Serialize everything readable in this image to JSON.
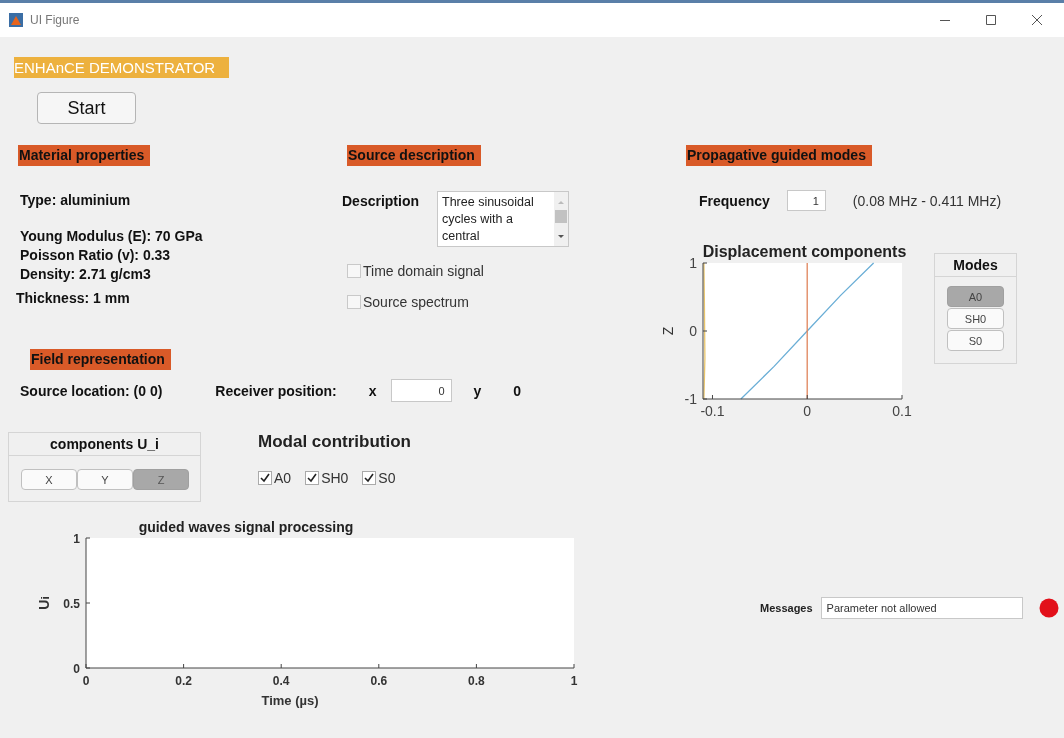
{
  "window": {
    "title": "UI Figure"
  },
  "banner": "ENHAnCE DEMONSTRATOR",
  "start_button": "Start",
  "material": {
    "heading": "Material properties",
    "lines": [
      "Type: aluminium",
      "Young Modulus (E): 70 GPa",
      "Poisson Ratio  (v): 0.33",
      "Density: 2.71 g/cm3",
      "Thickness: 1 mm"
    ]
  },
  "source": {
    "heading": "Source description",
    "description_label": "Description",
    "description": "Three sinusoidal cycles with a central",
    "options": [
      {
        "label": "Time domain signal",
        "checked": false
      },
      {
        "label": "Source spectrum",
        "checked": false
      }
    ]
  },
  "modes": {
    "heading": "Propagative guided modes",
    "frequency_label": "Frequency",
    "frequency": "1",
    "range": "(0.08 MHz - 0.411 MHz)",
    "chart_data": {
      "type": "line",
      "title": "Displacement components",
      "ylabel": "Z",
      "xlim": [
        -0.11,
        0.1
      ],
      "ylim": [
        -1,
        1
      ],
      "xticks": [
        -0.1,
        0,
        0.1
      ],
      "yticks": [
        -1,
        0,
        1
      ],
      "series": [
        {
          "color": "#6aaed6",
          "x": [
            -0.07,
            -0.035,
            0,
            0.035,
            0.07
          ],
          "values": [
            -1,
            -0.52,
            0,
            0.52,
            1
          ]
        },
        {
          "color": "#e0845a",
          "x": [
            0,
            0
          ],
          "values": [
            -1,
            1
          ]
        },
        {
          "color": "#e8c46a",
          "x": [
            -0.109,
            -0.108,
            -0.1085,
            -0.109
          ],
          "values": [
            -1,
            -0.4,
            0.4,
            1
          ]
        }
      ]
    },
    "panel_title": "Modes",
    "buttons": [
      {
        "label": "A0",
        "selected": true
      },
      {
        "label": "SH0",
        "selected": false
      },
      {
        "label": "S0",
        "selected": false
      }
    ]
  },
  "field": {
    "heading": "Field representation",
    "source_location": "Source location: (0 0)",
    "receiver_label": "Receiver position:",
    "x_label": "x",
    "x_value": "0",
    "y_label": "y",
    "y_value": "0",
    "components": {
      "title": "components U_i",
      "buttons": [
        {
          "label": "X",
          "selected": false
        },
        {
          "label": "Y",
          "selected": false
        },
        {
          "label": "Z",
          "selected": true
        }
      ]
    },
    "modal_title": "Modal contribution",
    "modal": [
      {
        "label": "A0",
        "checked": true
      },
      {
        "label": "SH0",
        "checked": true
      },
      {
        "label": "S0",
        "checked": true
      }
    ]
  },
  "signal_chart": {
    "chart_data": {
      "type": "line",
      "title": "guided waves signal processing",
      "xlabel": "Time  (µs)",
      "ylabel": "U$_{i}$",
      "xlim": [
        0,
        1
      ],
      "ylim": [
        0,
        1
      ],
      "xticks": [
        0,
        0.2,
        0.4,
        0.6,
        0.8,
        1
      ],
      "yticks": [
        0,
        0.5,
        1
      ]
    }
  },
  "messages": {
    "label": "Messages",
    "text": "Parameter not allowed",
    "lamp": {
      "color": "#e2101a"
    }
  }
}
